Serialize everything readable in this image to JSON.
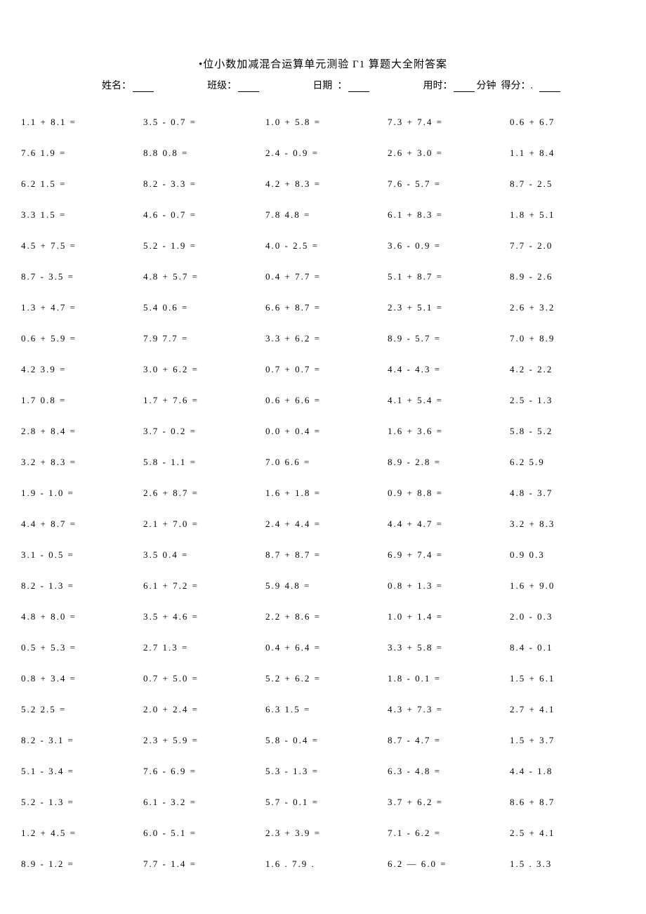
{
  "title": "•位小数加减混合运算单元测验 Γ1 算题大全附答案",
  "header": {
    "name_label": "姓名：",
    "class_label": "班级：",
    "date_label": "日期",
    "time_label": "用时：",
    "time_unit": "分钟",
    "score_label": "得分："
  },
  "problems": [
    [
      "1.1 + 8.1 =",
      "3.5 - 0.7 =",
      "1.0 + 5.8 =",
      "7.3 + 7.4 =",
      "0.6 + 6.7"
    ],
    [
      "7.6   1.9 =",
      "8.8   0.8 =",
      "2.4 - 0.9 =",
      "2.6 + 3.0 =",
      "1.1 + 8.4"
    ],
    [
      "6.2   1.5 =",
      "8.2 - 3.3 =",
      "4.2 + 8.3 =",
      "7.6 - 5.7 =",
      "8.7 - 2.5"
    ],
    [
      "3.3   1.5 =",
      "4.6 - 0.7 =",
      "7.8   4.8 =",
      "6.1 + 8.3 =",
      "1.8 + 5.1"
    ],
    [
      "4.5 + 7.5 =",
      "5.2 - 1.9 =",
      "4.0 - 2.5 =",
      "3.6 - 0.9 =",
      "7.7 - 2.0"
    ],
    [
      "8.7 - 3.5 =",
      "4.8 + 5.7 =",
      "0.4 + 7.7 =",
      "5.1 + 8.7 =",
      "8.9 - 2.6"
    ],
    [
      "1.3 + 4.7 =",
      "5.4   0.6 =",
      "6.6 + 8.7 =",
      "2.3 + 5.1 =",
      "2.6 + 3.2"
    ],
    [
      "0.6 + 5.9 =",
      "7.9   7.7 =",
      "3.3 + 6.2 =",
      "8.9 - 5.7 =",
      "7.0 + 8.9"
    ],
    [
      "4.2   3.9 =",
      "3.0 + 6.2 =",
      "0.7 + 0.7 =",
      "4.4 - 4.3 =",
      "4.2 - 2.2"
    ],
    [
      "1.7   0.8 =",
      "1.7 + 7.6 =",
      "0.6 + 6.6 =",
      "4.1 + 5.4 =",
      "2.5 - 1.3"
    ],
    [
      "2.8 + 8.4 =",
      "3.7 - 0.2 =",
      "0.0 + 0.4 =",
      "1.6 + 3.6 =",
      "5.8 - 5.2"
    ],
    [
      "3.2 + 8.3 =",
      "5.8 - 1.1 =",
      "7.0   6.6 =",
      "8.9 - 2.8 =",
      "6.2   5.9"
    ],
    [
      "1.9 - 1.0 =",
      "2.6 + 8.7 =",
      "1.6 + 1.8 =",
      "0.9 + 8.8 =",
      "4.8 - 3.7"
    ],
    [
      "4.4 + 8.7 =",
      "2.1 + 7.0 =",
      "2.4 + 4.4 =",
      "4.4 + 4.7 =",
      "3.2 + 8.3"
    ],
    [
      "3.1 - 0.5 =",
      "3.5   0.4 =",
      "8.7 + 8.7 =",
      "6.9 + 7.4 =",
      "0.9   0.3"
    ],
    [
      "8.2 - 1.3 =",
      "6.1 + 7.2 =",
      "5.9   4.8 =",
      "0.8 + 1.3 =",
      "1.6 + 9.0"
    ],
    [
      "4.8 + 8.0 =",
      "3.5 + 4.6 =",
      "2.2 + 8.6 =",
      "1.0 + 1.4 =",
      "2.0 - 0.3"
    ],
    [
      "0.5 + 5.3 =",
      "2.7   1.3 =",
      "0.4 + 6.4 =",
      "3.3 + 5.8 =",
      "8.4 - 0.1"
    ],
    [
      "0.8 + 3.4 =",
      "0.7 + 5.0 =",
      "5.2 + 6.2 =",
      "1.8 - 0.1 =",
      "1.5 + 6.1"
    ],
    [
      "5.2   2.5 =",
      "2.0 + 2.4 =",
      "6.3   1.5 =",
      "4.3 + 7.3 =",
      "2.7 + 4.1"
    ],
    [
      "8.2 - 3.1 =",
      "2.3 + 5.9 =",
      "5.8 - 0.4 =",
      "8.7 - 4.7 =",
      "1.5 + 3.7"
    ],
    [
      "5.1 - 3.4 =",
      "7.6 - 6.9 =",
      "5.3 - 1.3 =",
      "6.3 - 4.8 =",
      "4.4 - 1.8"
    ],
    [
      "5.2 - 1.3 =",
      "6.1 - 3.2 =",
      "5.7 - 0.1 =",
      "3.7 + 6.2 =",
      "8.6 + 8.7"
    ],
    [
      "1.2 + 4.5 =",
      "6.0 - 5.1 =",
      "2.3 + 3.9 =",
      "7.1 - 6.2 =",
      "2.5 + 4.1"
    ],
    [
      "8.9 - 1.2 =",
      "7.7 - 1.4 =",
      "1.6 . 7.9 .",
      "6.2 — 6.0 =",
      "1.5 . 3.3"
    ]
  ]
}
